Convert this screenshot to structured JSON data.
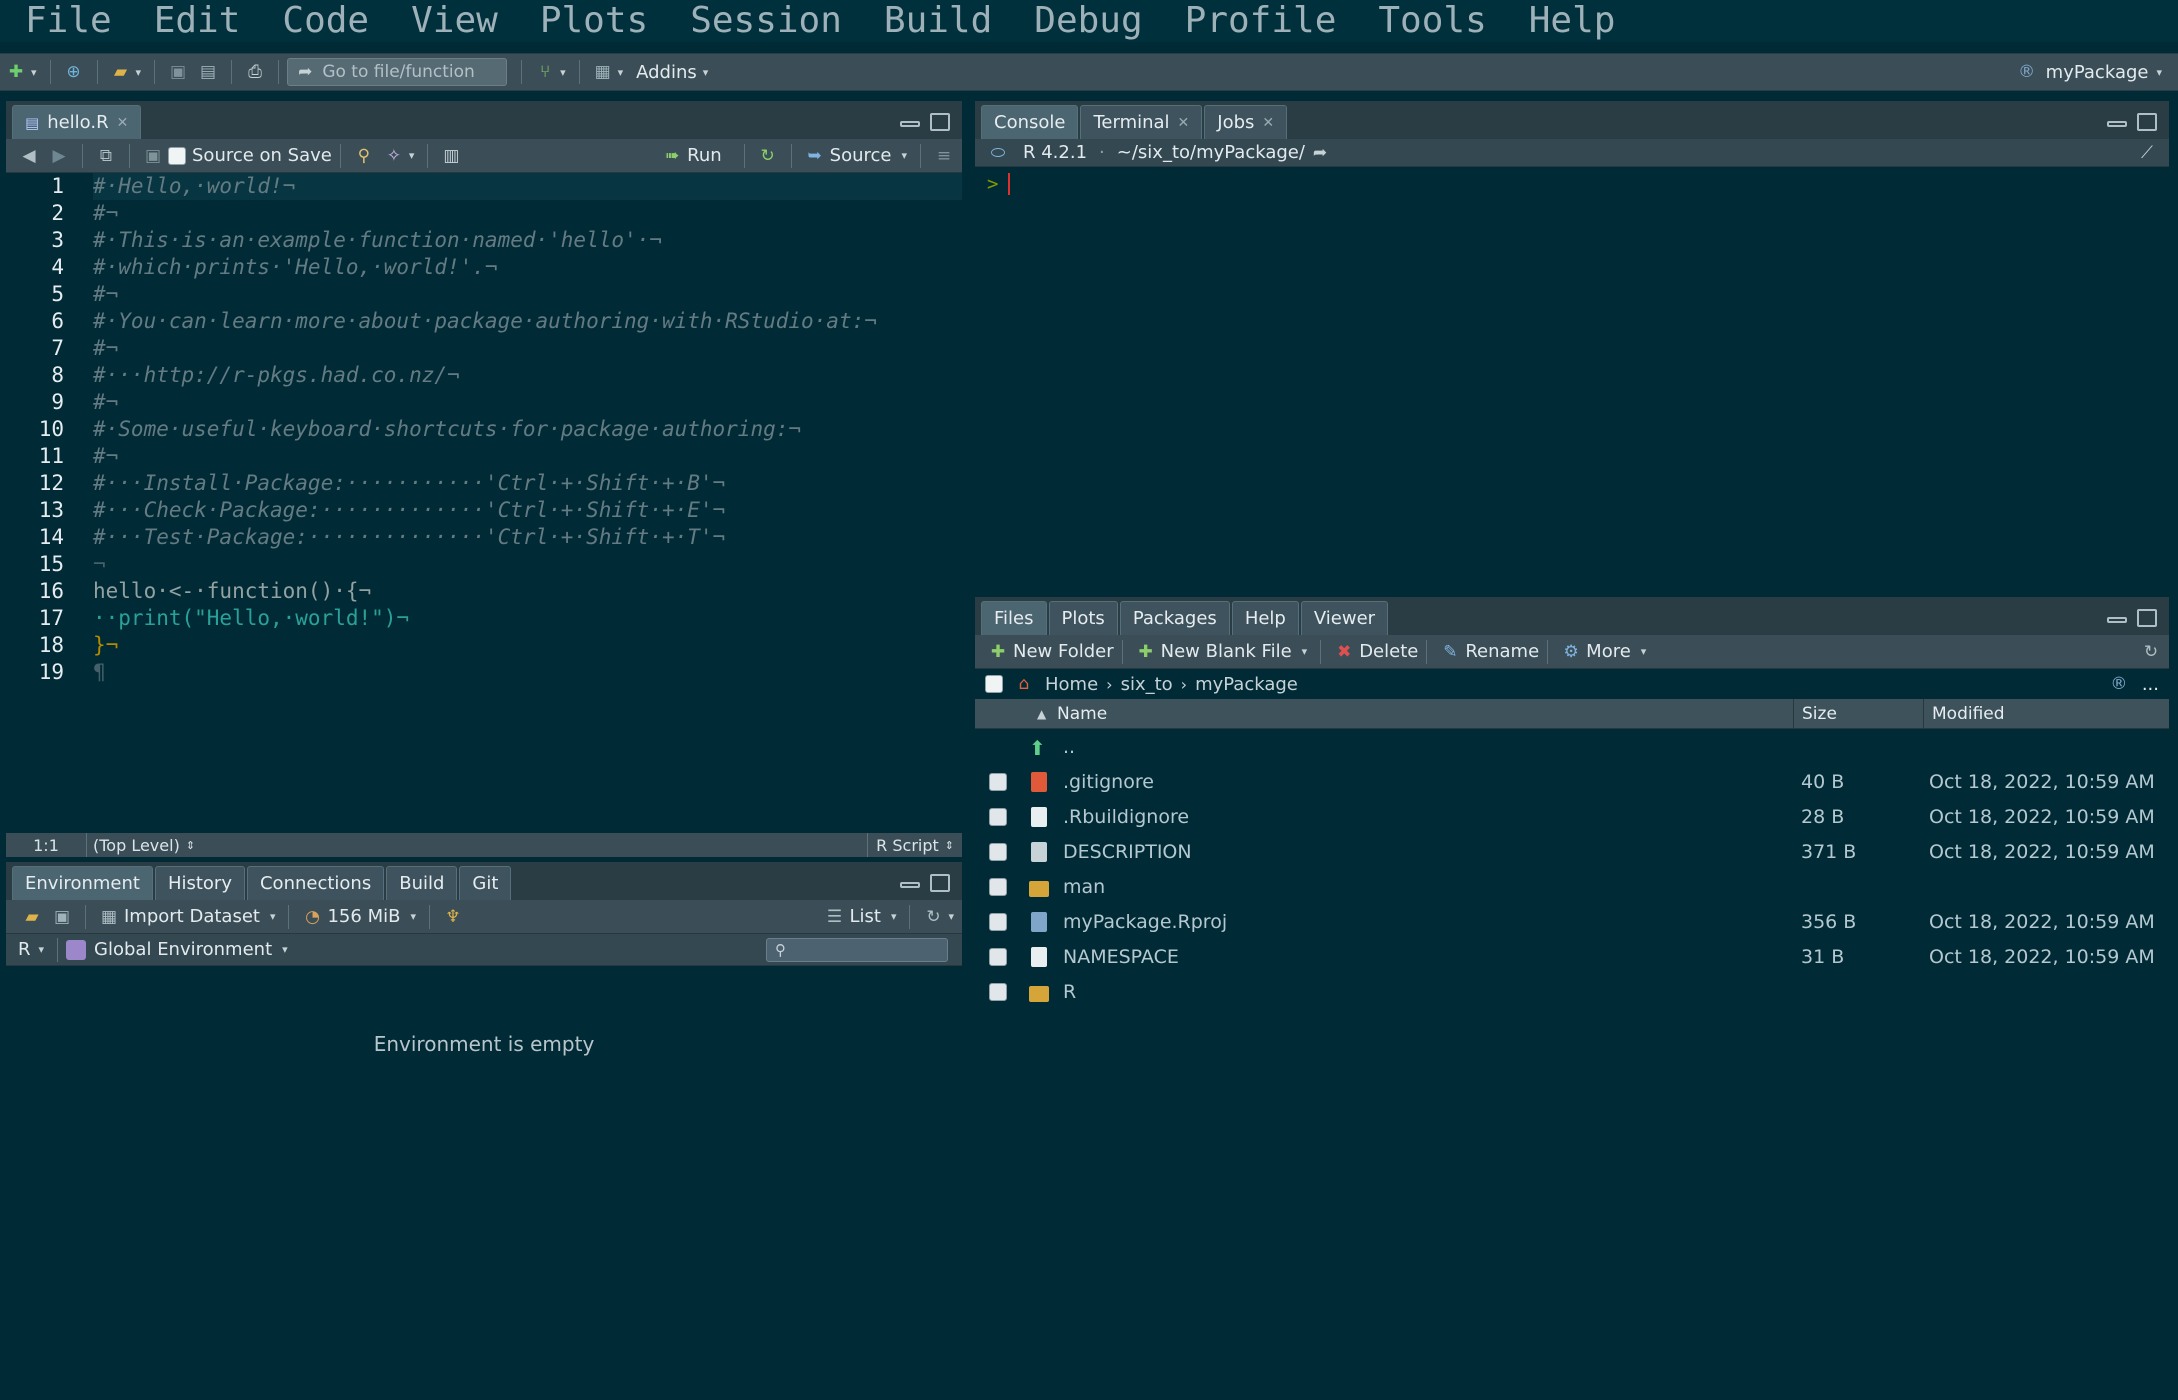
{
  "menu": [
    "File",
    "Edit",
    "Code",
    "View",
    "Plots",
    "Session",
    "Build",
    "Debug",
    "Profile",
    "Tools",
    "Help"
  ],
  "toolbar": {
    "goto_placeholder": "Go to file/function",
    "addins": "Addins",
    "project": "myPackage"
  },
  "source": {
    "tab": "hello.R",
    "source_on_save": "Source on Save",
    "run": "Run",
    "source": "Source",
    "line_numbers": [
      "1",
      "2",
      "3",
      "4",
      "5",
      "6",
      "7",
      "8",
      "9",
      "10",
      "11",
      "12",
      "13",
      "14",
      "15",
      "16",
      "17",
      "18",
      "19"
    ],
    "lines": [
      "#·Hello,·world!¬",
      "#¬",
      "#·This·is·an·example·function·named·'hello'·¬",
      "#·which·prints·'Hello,·world!'.¬",
      "#¬",
      "#·You·can·learn·more·about·package·authoring·with·RStudio·at:¬",
      "#¬",
      "#···http://r-pkgs.had.co.nz/¬",
      "#¬",
      "#·Some·useful·keyboard·shortcuts·for·package·authoring:¬",
      "#¬",
      "#···Install·Package:···········'Ctrl·+·Shift·+·B'¬",
      "#···Check·Package:·············'Ctrl·+·Shift·+·E'¬",
      "#···Test·Package:··············'Ctrl·+·Shift·+·T'¬",
      "¬",
      "hello·<-·function()·{¬",
      "··print(\"Hello,·world!\")¬",
      "}¬",
      "¶"
    ],
    "status_pos": "1:1",
    "status_scope": "(Top Level)",
    "status_type": "R Script"
  },
  "console": {
    "tabs": [
      "Console",
      "Terminal",
      "Jobs"
    ],
    "r_version": "R 4.2.1",
    "sep": "·",
    "path": "~/six_to/myPackage/",
    "prompt": ">"
  },
  "env": {
    "tabs": [
      "Environment",
      "History",
      "Connections",
      "Build",
      "Git"
    ],
    "import": "Import Dataset",
    "memory": "156 MiB",
    "list": "List",
    "lang": "R",
    "scope": "Global Environment",
    "empty": "Environment is empty"
  },
  "files": {
    "tabs": [
      "Files",
      "Plots",
      "Packages",
      "Help",
      "Viewer"
    ],
    "new_folder": "New Folder",
    "new_blank": "New Blank File",
    "delete": "Delete",
    "rename": "Rename",
    "more": "More",
    "crumbs": [
      "Home",
      "six_to",
      "myPackage"
    ],
    "ellipsis": "...",
    "col_name": "Name",
    "col_size": "Size",
    "col_modified": "Modified",
    "up": "..",
    "rows": [
      {
        "name": ".gitignore",
        "size": "40 B",
        "modified": "Oct 18, 2022, 10:59 AM",
        "icon": "git-file-icon"
      },
      {
        "name": ".Rbuildignore",
        "size": "28 B",
        "modified": "Oct 18, 2022, 10:59 AM",
        "icon": "file-icon"
      },
      {
        "name": "DESCRIPTION",
        "size": "371 B",
        "modified": "Oct 18, 2022, 10:59 AM",
        "icon": "description-file-icon"
      },
      {
        "name": "man",
        "size": "",
        "modified": "",
        "icon": "folder-icon"
      },
      {
        "name": "myPackage.Rproj",
        "size": "356 B",
        "modified": "Oct 18, 2022, 10:59 AM",
        "icon": "rproj-file-icon"
      },
      {
        "name": "NAMESPACE",
        "size": "31 B",
        "modified": "Oct 18, 2022, 10:59 AM",
        "icon": "file-icon"
      },
      {
        "name": "R",
        "size": "",
        "modified": "",
        "icon": "folder-icon"
      }
    ]
  },
  "colors": {
    "bg": "#002b36",
    "comment": "#586e75",
    "keyword": "#b58900",
    "string": "#2aa198",
    "folder": "#d6a539"
  }
}
